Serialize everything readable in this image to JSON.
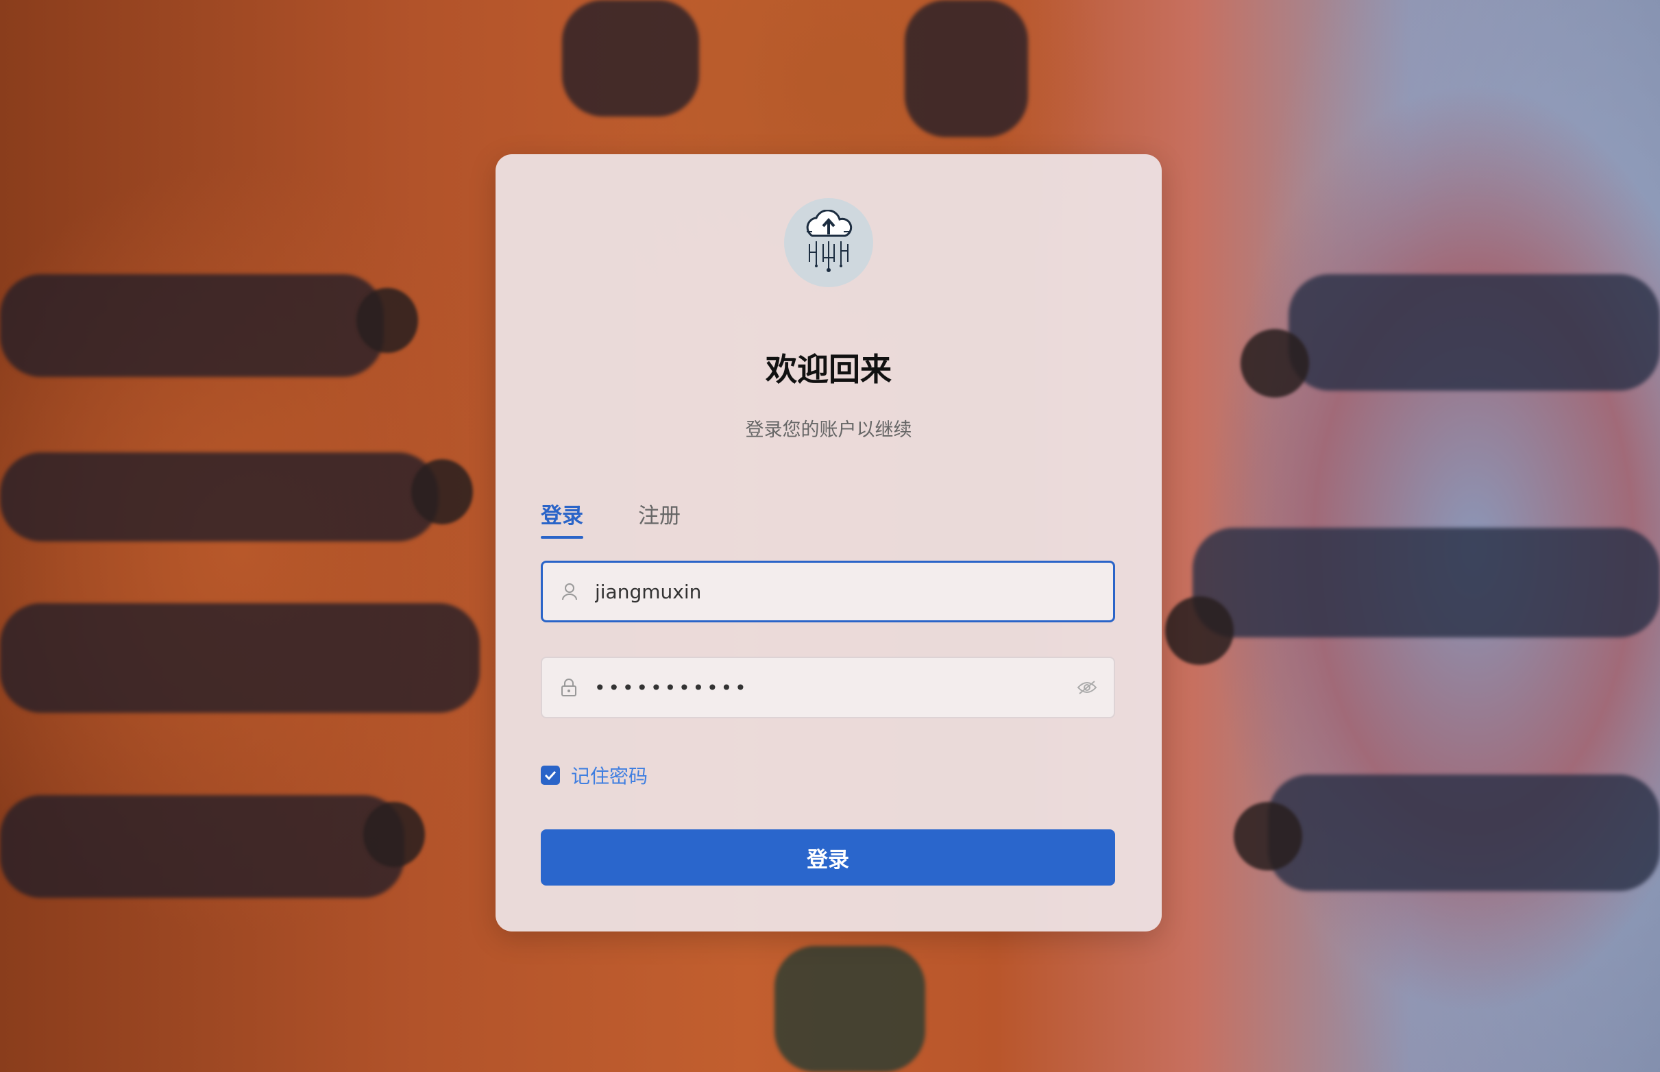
{
  "background": {
    "description_colors": [
      "#b2532a",
      "#8f93b0"
    ]
  },
  "logo": {
    "icon": "cloud-upload-circuit-icon"
  },
  "header": {
    "title": "欢迎回来",
    "subtitle": "登录您的账户以继续"
  },
  "tabs": [
    {
      "label": "登录",
      "active": true
    },
    {
      "label": "注册",
      "active": false
    }
  ],
  "form": {
    "username": {
      "value": "jiangmuxin",
      "icon": "user-icon"
    },
    "password": {
      "value": "•••••••••••",
      "icon": "lock-icon",
      "toggle_icon": "eye-hidden-icon"
    },
    "remember": {
      "label": "记住密码",
      "checked": true
    },
    "submit_label": "登录"
  },
  "colors": {
    "accent": "#2a64c8"
  }
}
